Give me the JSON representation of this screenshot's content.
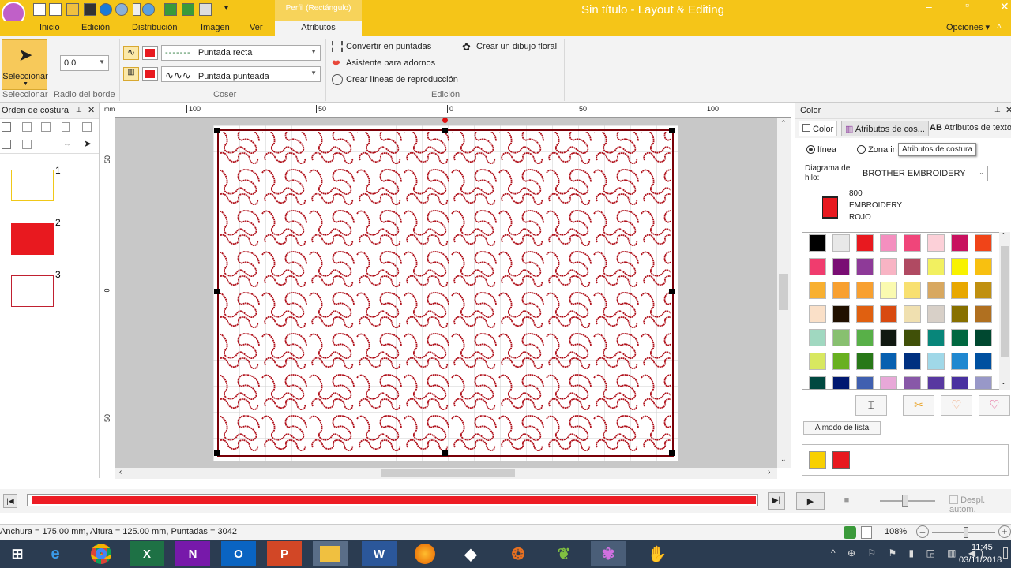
{
  "titlebar": {
    "context_tab": "Perfil (Rectángulo)",
    "title": "Sin título - Layout & Editing",
    "options": "Opciones"
  },
  "tabs": [
    "Inicio",
    "Edición",
    "Distribución",
    "Imagen",
    "Ver",
    "Atributos"
  ],
  "ribbon": {
    "select_label": "Seleccionar",
    "group_select": "Seleccionar",
    "radius_value": "0.0",
    "group_radius": "Radio del borde",
    "stitch1": "Puntada recta",
    "stitch2": "Puntada punteada",
    "group_sew": "Coser",
    "cmd_convert": "Convertir en puntadas",
    "cmd_wizard": "Asistente para adornos",
    "cmd_lines": "Crear líneas de reproducción",
    "cmd_floral": "Crear un dibujo floral",
    "group_edit": "Edición"
  },
  "leftpanel": {
    "title": "Orden de costura",
    "items": [
      "1",
      "2",
      "3"
    ]
  },
  "ruler": {
    "top": [
      "100",
      "50",
      "0",
      "50",
      "100"
    ],
    "left": [
      "50",
      "0",
      "50"
    ],
    "unit": "mm"
  },
  "rightpanel": {
    "title": "Color",
    "tab_color": "Color",
    "tab_attr": "Atributos de cos...",
    "tab_text": "Atributos de texto",
    "radio_line": "línea",
    "radio_zone": "Zona in",
    "tooltip": "Atributos de costura",
    "thread_label": "Diagrama de hilo:",
    "thread_value": "BROTHER EMBROIDERY",
    "current_code": "800",
    "current_brand": "EMBROIDERY",
    "current_name": "ROJO",
    "list_mode": "A modo de lista",
    "palette": [
      "#000000",
      "#e8e8e8",
      "#e8191f",
      "#f48fbf",
      "#f0457a",
      "#fcd0d8",
      "#c8115f",
      "#f04418",
      "#f03c6e",
      "#7a0e74",
      "#8e3a98",
      "#f8b4c4",
      "#b04a62",
      "#f2f060",
      "#f8f200",
      "#f8c010",
      "#f8b030",
      "#f8a030",
      "#f8a030",
      "#fafab0",
      "#f8e070",
      "#d8a860",
      "#e8a800",
      "#c09010",
      "#fae0c8",
      "#201000",
      "#e06010",
      "#d84a10",
      "#f0e0b0",
      "#d8d0c8",
      "#887000",
      "#b07020",
      "#a0d8c0",
      "#88c070",
      "#58b048",
      "#101810",
      "#405008",
      "#08867a",
      "#006840",
      "#004830",
      "#d8e860",
      "#68b020",
      "#287818",
      "#0860b0",
      "#003080",
      "#a0d8e8",
      "#2088d0",
      "#0050a0",
      "#004840",
      "#001870",
      "#4060b0",
      "#e8a8d8",
      "#8858a8",
      "#5838a0",
      "#4830a0",
      "#9898c8"
    ],
    "used_colors": [
      "#f8d000",
      "#e8191f"
    ]
  },
  "status": {
    "text": "Anchura = 175.00 mm, Altura = 125.00 mm, Puntadas = 3042",
    "zoom": "108%",
    "auto_move": "Despl. autom."
  },
  "taskbar": {
    "time": "11:45",
    "date": "03/11/2018"
  }
}
